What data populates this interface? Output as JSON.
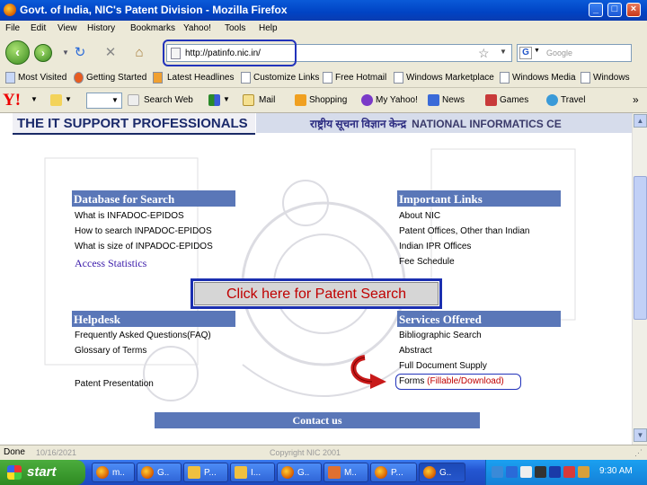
{
  "window": {
    "title": "Govt. of India, NIC's Patent Division - Mozilla Firefox"
  },
  "menu": [
    "File",
    "Edit",
    "View",
    "History",
    "Bookmarks",
    "Yahoo!",
    "Tools",
    "Help"
  ],
  "nav": {
    "url": "http://patinfo.nic.in/",
    "search_placeholder": "Google"
  },
  "bookmarks": [
    "Most Visited",
    "Getting Started",
    "Latest Headlines",
    "Customize Links",
    "Free Hotmail",
    "Windows Marketplace",
    "Windows Media",
    "Windows"
  ],
  "yahoo_toolbar": {
    "logo": "Y!",
    "items": [
      "Search Web",
      "Mail",
      "Shopping",
      "My Yahoo!",
      "News",
      "Games",
      "Travel"
    ],
    "more": "»"
  },
  "page": {
    "banner_left": "THE IT SUPPORT PROFESSIONALS",
    "banner_hindi": "राष्ट्रीय सूचना विज्ञान केन्द्र",
    "banner_right": "NATIONAL INFORMATICS CE",
    "database": {
      "heading": "Database for Search",
      "links": [
        "What is INFADOC-EPIDOS",
        "How to search INPADOC-EPIDOS",
        "What is size of INPADOC-EPIDOS",
        "Access Statistics"
      ]
    },
    "important": {
      "heading": "Important Links",
      "links": [
        "About NIC",
        "Patent Offices, Other than Indian",
        "Indian IPR Offices",
        "Fee Schedule"
      ]
    },
    "patent_search_button": "Click here for Patent Search",
    "helpdesk": {
      "heading": "Helpdesk",
      "links": [
        "Frequently Asked Questions(FAQ)",
        "Glossary of Terms",
        "Patent Presentation"
      ]
    },
    "services": {
      "heading": "Services Offered",
      "links": [
        "Bibliographic Search",
        "Abstract",
        "Full Document Supply"
      ],
      "forms": "Forms",
      "forms_link": "(Fillable/Download)"
    },
    "contact": "Contact us"
  },
  "status": {
    "text": "Done",
    "left_faint": "10/16/2021",
    "mid_faint": "Copyright NIC 2001"
  },
  "taskbar": {
    "start": "start",
    "tasks": [
      "m..",
      "G..",
      "P...",
      "I...",
      "G..",
      "M..",
      "P...",
      "G.."
    ],
    "clock": "9:30 AM"
  },
  "colors": {
    "section_bg": "#5a77b8",
    "highlight": "#2233bb",
    "patent_text": "#c00000"
  }
}
